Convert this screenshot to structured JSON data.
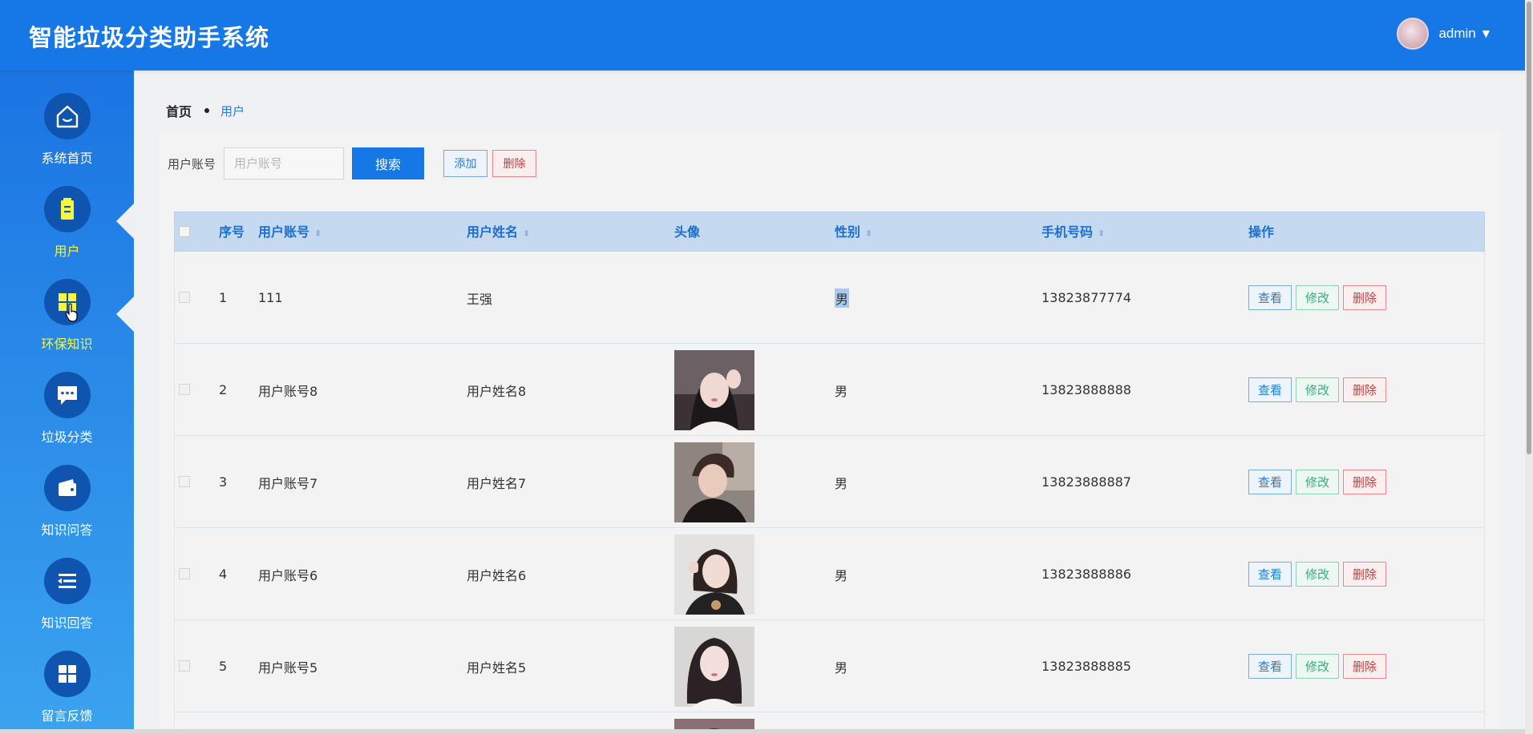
{
  "header": {
    "title": "智能垃圾分类助手系统",
    "username": "admin"
  },
  "sidebar": {
    "items": [
      {
        "label": "系统首页",
        "icon": "home-icon",
        "state": "normal"
      },
      {
        "label": "用户",
        "icon": "clipboard-icon",
        "state": "active"
      },
      {
        "label": "环保知识",
        "icon": "grid-icon",
        "state": "hover"
      },
      {
        "label": "垃圾分类",
        "icon": "chat-icon",
        "state": "normal"
      },
      {
        "label": "知识问答",
        "icon": "wallet-icon",
        "state": "normal"
      },
      {
        "label": "知识回答",
        "icon": "list-icon",
        "state": "normal"
      },
      {
        "label": "留言反馈",
        "icon": "apps-icon",
        "state": "normal"
      }
    ]
  },
  "breadcrumb": {
    "home": "首页",
    "current": "用户"
  },
  "search": {
    "label": "用户账号",
    "placeholder": "用户账号",
    "value": "",
    "search_button": "搜索",
    "add_button": "添加",
    "delete_button": "删除"
  },
  "table": {
    "headers": {
      "index": "序号",
      "account": "用户账号",
      "name": "用户姓名",
      "avatar": "头像",
      "gender": "性别",
      "phone": "手机号码",
      "actions": "操作"
    },
    "actions": {
      "view": "查看",
      "edit": "修改",
      "delete": "删除"
    },
    "rows": [
      {
        "index": "1",
        "account": "111",
        "name": "王强",
        "avatar": "",
        "gender": "男",
        "phone": "13823877774"
      },
      {
        "index": "2",
        "account": "用户账号8",
        "name": "用户姓名8",
        "avatar": "photo",
        "gender": "男",
        "phone": "13823888888"
      },
      {
        "index": "3",
        "account": "用户账号7",
        "name": "用户姓名7",
        "avatar": "photo",
        "gender": "男",
        "phone": "13823888887"
      },
      {
        "index": "4",
        "account": "用户账号6",
        "name": "用户姓名6",
        "avatar": "photo",
        "gender": "男",
        "phone": "13823888886"
      },
      {
        "index": "5",
        "account": "用户账号5",
        "name": "用户姓名5",
        "avatar": "photo",
        "gender": "男",
        "phone": "13823888885"
      }
    ]
  },
  "colors": {
    "primary": "#1677e6",
    "sidebar_active": "#f5f542",
    "table_header_bg": "#c5d9f1",
    "danger": "#d23a3a",
    "success": "#3aab7d"
  }
}
